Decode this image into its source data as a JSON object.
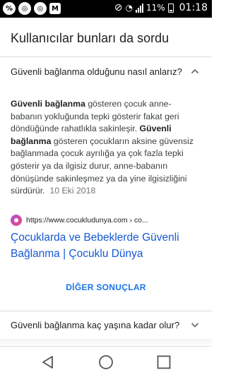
{
  "status_bar": {
    "icons_left": [
      "percent-icon",
      "chrome-icon",
      "chrome-icon",
      "gmail-icon"
    ],
    "battery_percent": "11%",
    "time": "01:18"
  },
  "card": {
    "title": "Kullanıcılar bunları da sordu",
    "question_expanded": "Güvenli bağlanma olduğunu nasıl anlarız?",
    "answer": {
      "seg1_bold": "Güvenli bağlanma",
      "seg2": " gösteren çocuk anne-babanın yokluğunda tepki gösterir fakat geri döndüğünde rahatlıkla sakinleşir. ",
      "seg3_bold": "Güvenli bağlanma",
      "seg4": " gösteren çocukların aksine güvensiz bağlanmada çocuk ayrılığa ya çok fazla tepki gösterir ya da ilgisiz durur, anne-babanın dönüşünde sakinleşmez ya da yine ilgisizliğini sürdürür.",
      "date": "10 Eki 2018"
    },
    "source_url": "https://www.cocukludunya.com › co...",
    "result_title": "Çocuklarda ve Bebeklerde Güvenli Bağlanma | Çocuklu Dünya",
    "more_results": "DİĞER SONUÇLAR",
    "question_collapsed": "Güvenli bağlanma kaç yaşına kadar olur?"
  },
  "colors": {
    "link": "#1558d6",
    "more_button": "#1a73e8",
    "divider": "#dadce0"
  }
}
